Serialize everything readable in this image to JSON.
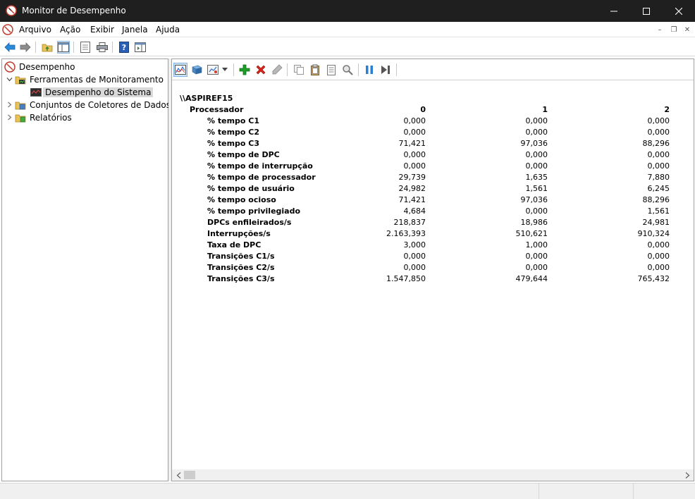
{
  "window": {
    "title": "Monitor de Desempenho"
  },
  "menu": {
    "items": [
      "Arquivo",
      "Ação",
      "Exibir",
      "Janela",
      "Ajuda"
    ]
  },
  "tree": {
    "root": "Desempenho",
    "monitoring_tools": "Ferramentas de Monitoramento",
    "system_performance": "Desempenho do Sistema",
    "data_collector_sets": "Conjuntos de Coletores de Dados",
    "reports": "Relatórios"
  },
  "report": {
    "computer": "\\\\ASPIREF15",
    "object": "Processador",
    "instances": [
      "0",
      "1",
      "2"
    ],
    "counters": [
      {
        "name": "% tempo C1",
        "values": [
          "0,000",
          "0,000",
          "0,000"
        ]
      },
      {
        "name": "% tempo C2",
        "values": [
          "0,000",
          "0,000",
          "0,000"
        ]
      },
      {
        "name": "% tempo C3",
        "values": [
          "71,421",
          "97,036",
          "88,296"
        ]
      },
      {
        "name": "% tempo de DPC",
        "values": [
          "0,000",
          "0,000",
          "0,000"
        ]
      },
      {
        "name": "% tempo de interrupção",
        "values": [
          "0,000",
          "0,000",
          "0,000"
        ]
      },
      {
        "name": "% tempo de processador",
        "values": [
          "29,739",
          "1,635",
          "7,880"
        ]
      },
      {
        "name": "% tempo de usuário",
        "values": [
          "24,982",
          "1,561",
          "6,245"
        ]
      },
      {
        "name": "% tempo ocioso",
        "values": [
          "71,421",
          "97,036",
          "88,296"
        ]
      },
      {
        "name": "% tempo privilegiado",
        "values": [
          "4,684",
          "0,000",
          "1,561"
        ]
      },
      {
        "name": "DPCs enfileirados/s",
        "values": [
          "218,837",
          "18,986",
          "24,981"
        ]
      },
      {
        "name": "Interrupções/s",
        "values": [
          "2.163,393",
          "510,621",
          "910,324"
        ]
      },
      {
        "name": "Taxa de DPC",
        "values": [
          "3,000",
          "1,000",
          "0,000"
        ]
      },
      {
        "name": "Transições C1/s",
        "values": [
          "0,000",
          "0,000",
          "0,000"
        ]
      },
      {
        "name": "Transições C2/s",
        "values": [
          "0,000",
          "0,000",
          "0,000"
        ]
      },
      {
        "name": "Transições C3/s",
        "values": [
          "1.547,850",
          "479,644",
          "765,432"
        ]
      }
    ]
  },
  "icons": {
    "app": "perfmon-icon",
    "back": "back-arrow-icon",
    "forward": "forward-arrow-icon",
    "up": "up-folder-icon",
    "show_hide_tree": "show-hide-tree-icon",
    "properties": "properties-icon",
    "print": "print-icon",
    "help": "help-icon",
    "show_hide_action": "show-hide-action-pane-icon",
    "view_graph": "view-graph-icon",
    "view_histogram": "view-histogram-icon",
    "change_graph_type": "change-graph-type-icon",
    "add": "add-counter-icon",
    "delete": "delete-counter-icon",
    "highlight": "highlight-icon",
    "copy": "copy-properties-icon",
    "paste": "paste-counter-list-icon",
    "properties2": "properties-icon",
    "zoom": "zoom-icon",
    "freeze": "freeze-display-icon",
    "update": "update-data-icon"
  },
  "colors": {
    "titlebar": "#1f1f1f",
    "selected_tree": "#d9d9d9",
    "add_green": "#1e9e2a",
    "delete_red": "#d9231a",
    "pause_blue": "#2a7fd4"
  }
}
